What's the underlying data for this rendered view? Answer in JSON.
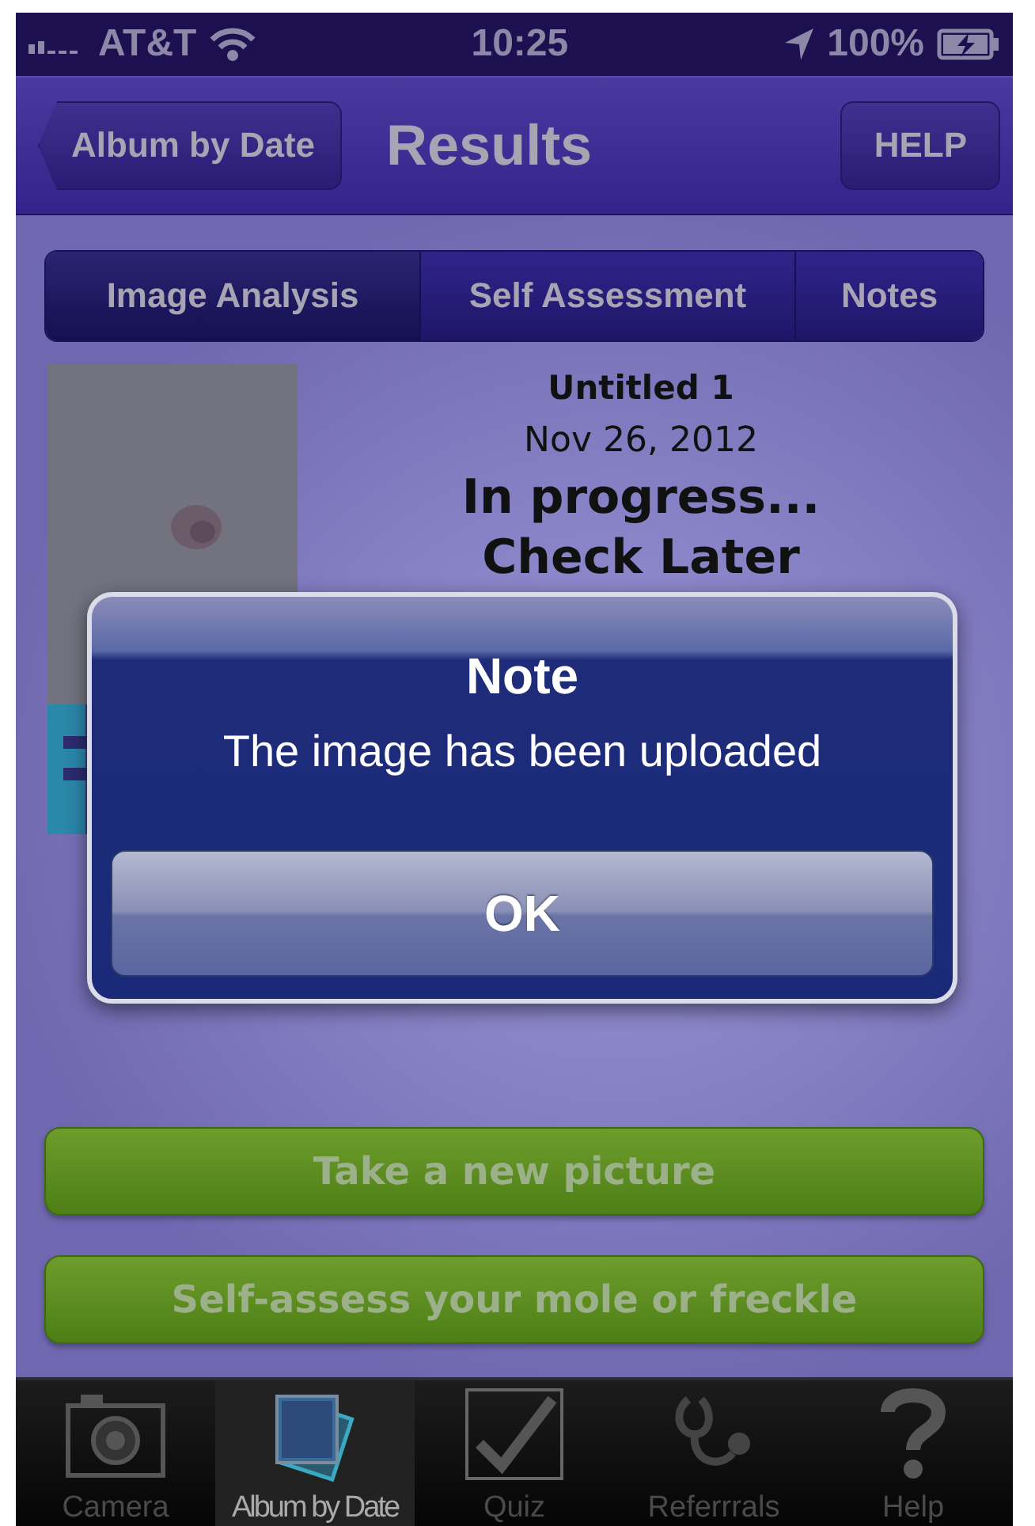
{
  "status_bar": {
    "carrier": "AT&T",
    "time": "10:25",
    "battery": "100%"
  },
  "nav_bar": {
    "back_button": "Album by Date",
    "title": "Results",
    "help_button": "HELP"
  },
  "segments": [
    {
      "label": "Image Analysis",
      "selected": true
    },
    {
      "label": "Self Assessment",
      "selected": false
    },
    {
      "label": "Notes",
      "selected": false
    }
  ],
  "result": {
    "name": "Untitled 1",
    "date": "Nov 26, 2012",
    "status": "In progress...",
    "status_note": "Check Later"
  },
  "alert": {
    "title": "Note",
    "message": "The image has been uploaded",
    "button": "OK"
  },
  "actions": [
    "Take a new picture",
    "Self-assess your mole or freckle"
  ],
  "tab_bar": [
    {
      "label": "Camera",
      "kind": "camera",
      "selected": false
    },
    {
      "label": "Album by Date",
      "kind": "album",
      "selected": true
    },
    {
      "label": "Quiz",
      "kind": "quiz",
      "selected": false
    },
    {
      "label": "Referrrals",
      "kind": "stethoscope",
      "selected": false
    },
    {
      "label": "Help",
      "kind": "help",
      "selected": false
    }
  ]
}
